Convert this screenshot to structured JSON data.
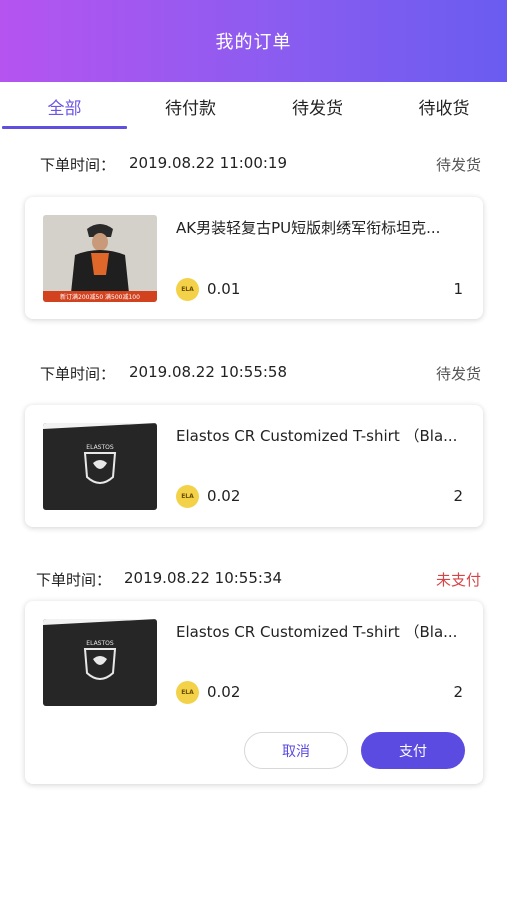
{
  "header": {
    "title": "我的订单"
  },
  "tabs": [
    {
      "label": "全部",
      "active": true
    },
    {
      "label": "待付款",
      "active": false
    },
    {
      "label": "待发货",
      "active": false
    },
    {
      "label": "待收货",
      "active": false
    }
  ],
  "orders": [
    {
      "time_label": "下单时间：",
      "time": "2019.08.22 11:00:19",
      "status": "待发货",
      "product_name": "AK男装轻复古PU短版刺绣军衔标坦克...",
      "currency": "ELA",
      "price": "0.01",
      "quantity": "1"
    },
    {
      "time_label": "下单时间：",
      "time": "2019.08.22 10:55:58",
      "status": "待发货",
      "product_name": "Elastos CR Customized T-shirt （Bla...",
      "currency": "ELA",
      "price": "0.02",
      "quantity": "2"
    },
    {
      "time_label": "下单时间：",
      "time": "2019.08.22 10:55:34",
      "status": "未支付",
      "product_name": "Elastos CR Customized T-shirt （Bla...",
      "currency": "ELA",
      "price": "0.02",
      "quantity": "2",
      "cancel_label": "取消",
      "pay_label": "支付"
    }
  ],
  "colors": {
    "accent": "#5b4be0",
    "unpaid": "#d64545",
    "coin": "#f3d24a"
  }
}
